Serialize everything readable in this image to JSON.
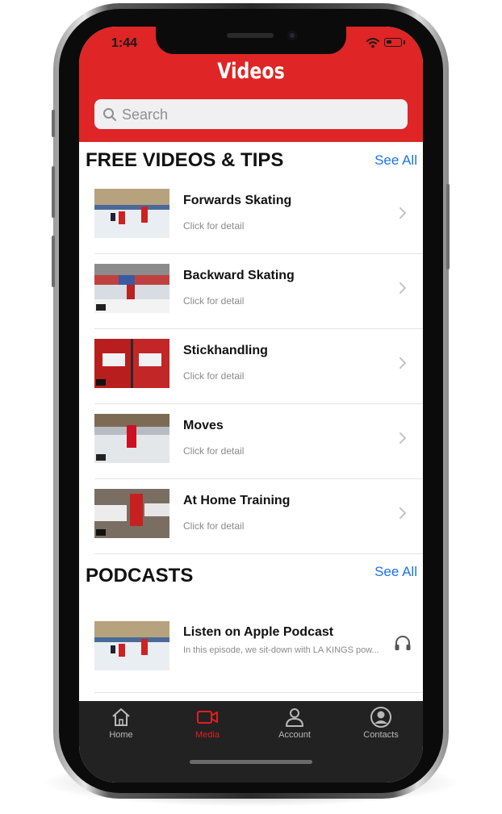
{
  "status": {
    "time": "1:44"
  },
  "header": {
    "title": "Videos",
    "search_placeholder": "Search",
    "accent_color": "#df2525"
  },
  "free_videos": {
    "title": "FREE VIDEOS & TIPS",
    "see_all": "See All",
    "items": [
      {
        "title": "Forwards Skating",
        "subtitle": "Click for detail"
      },
      {
        "title": "Backward Skating",
        "subtitle": "Click for detail"
      },
      {
        "title": "Stickhandling",
        "subtitle": "Click for detail"
      },
      {
        "title": "Moves",
        "subtitle": "Click for detail"
      },
      {
        "title": "At Home Training",
        "subtitle": "Click for detail"
      }
    ]
  },
  "podcasts": {
    "title": "PODCASTS",
    "see_all": "See All",
    "items": [
      {
        "title": "Listen on Apple Podcast",
        "subtitle": "In this episode, we sit-down with LA KINGS pow..."
      }
    ]
  },
  "tabbar": {
    "items": [
      {
        "label": "Home",
        "icon": "home-icon"
      },
      {
        "label": "Media",
        "icon": "video-camera-icon",
        "active": true
      },
      {
        "label": "Account",
        "icon": "person-icon"
      },
      {
        "label": "Contacts",
        "icon": "account-circle-icon"
      }
    ],
    "active_color": "#e11f1f"
  }
}
